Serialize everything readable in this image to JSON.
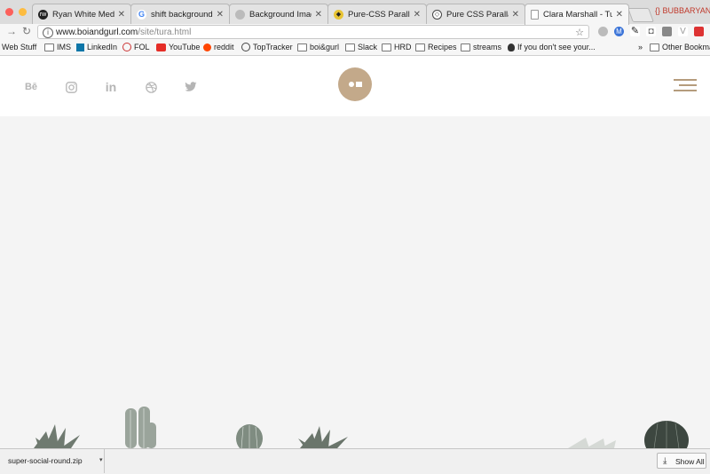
{
  "browser": {
    "tabs": [
      {
        "title": "Ryan White Media",
        "favicon": "rw-icon",
        "color": "#222222"
      },
      {
        "title": "shift background ima",
        "favicon": "google-icon",
        "color": "#4285f4"
      },
      {
        "title": "Background Image a",
        "favicon": "stack-icon",
        "color": "#888888"
      },
      {
        "title": "Pure-CSS Parallax S",
        "favicon": "codepen-yellow-icon",
        "color": "#e8c435"
      },
      {
        "title": "Pure CSS Parallax Ef",
        "favicon": "codepen-icon",
        "color": "#444444"
      },
      {
        "title": "Clara Marshall - Tura",
        "favicon": "page-icon",
        "color": "#999999"
      }
    ],
    "profile_name": "BUBBARYAN",
    "url_domain": "www.boiandgurl.com",
    "url_path": "/site/tura.html",
    "bookmarks": [
      "Web Stuff",
      "IMS",
      "LinkedIn",
      "FOL",
      "YouTube",
      "reddit",
      "TopTracker",
      "boi&gurl",
      "Slack",
      "HRD",
      "Recipes",
      "streams",
      "If you don't see your...",
      "Other Bookmarks"
    ],
    "bookmarks_overflow": "»"
  },
  "site": {
    "social": [
      "behance-icon",
      "instagram-icon",
      "linkedin-icon",
      "dribbble-icon",
      "twitter-icon"
    ],
    "behance_label": "Bē",
    "linkedin_label": "in",
    "accent": "#c3a98a"
  },
  "downloads": {
    "file": "super-social-round.zip",
    "show_all": "Show All"
  }
}
